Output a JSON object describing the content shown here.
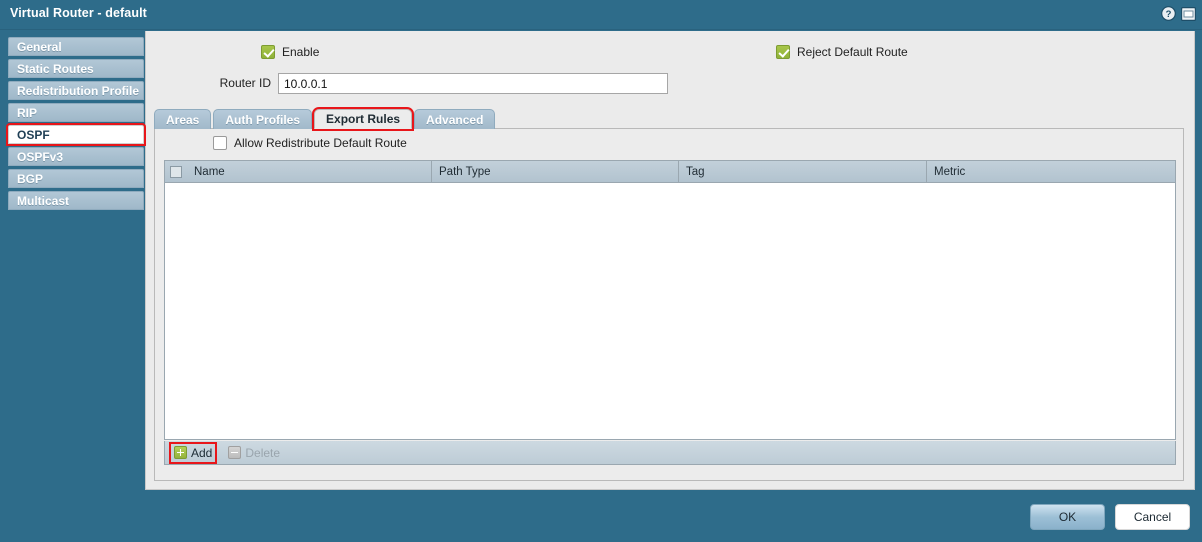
{
  "titlebar": {
    "title": "Virtual Router - default",
    "icons": [
      {
        "name": "help-icon",
        "glyph": "?"
      },
      {
        "name": "window-icon",
        "glyph": "▭"
      }
    ]
  },
  "sidebar": {
    "items": [
      {
        "label": "General",
        "selected": false,
        "highlighted": false
      },
      {
        "label": "Static Routes",
        "selected": false,
        "highlighted": false
      },
      {
        "label": "Redistribution Profile",
        "selected": false,
        "highlighted": false
      },
      {
        "label": "RIP",
        "selected": false,
        "highlighted": false
      },
      {
        "label": "OSPF",
        "selected": true,
        "highlighted": true
      },
      {
        "label": "OSPFv3",
        "selected": false,
        "highlighted": false
      },
      {
        "label": "BGP",
        "selected": false,
        "highlighted": false
      },
      {
        "label": "Multicast",
        "selected": false,
        "highlighted": false
      }
    ]
  },
  "main": {
    "enable": {
      "label": "Enable",
      "checked": true
    },
    "reject_default_route": {
      "label": "Reject Default Route",
      "checked": true
    },
    "router_id": {
      "label": "Router ID",
      "value": "10.0.0.1",
      "placeholder": ""
    },
    "tabs": [
      {
        "label": "Areas",
        "active": false,
        "highlighted": false
      },
      {
        "label": "Auth Profiles",
        "active": false,
        "highlighted": false
      },
      {
        "label": "Export Rules",
        "active": true,
        "highlighted": true
      },
      {
        "label": "Advanced",
        "active": false,
        "highlighted": false
      }
    ],
    "allow_redistribute_default_route": {
      "label": "Allow Redistribute Default Route",
      "checked": false
    },
    "table": {
      "columns": [
        "Name",
        "Path Type",
        "Tag",
        "Metric"
      ],
      "rows": []
    },
    "toolbar": {
      "add_label": "Add",
      "delete_label": "Delete",
      "delete_disabled": true,
      "add_highlighted": true
    }
  },
  "footer": {
    "ok_label": "OK",
    "cancel_label": "Cancel"
  },
  "colors": {
    "window_bg": "#2e6c8a",
    "panel_bg": "#ebebeb",
    "tab_body_bg": "#ececec",
    "highlight_red": "#e8161a",
    "checkbox_green": "#8fb239",
    "sidebar_item_bg": "#a8becd",
    "table_header_bg": "#b2c3cf"
  }
}
